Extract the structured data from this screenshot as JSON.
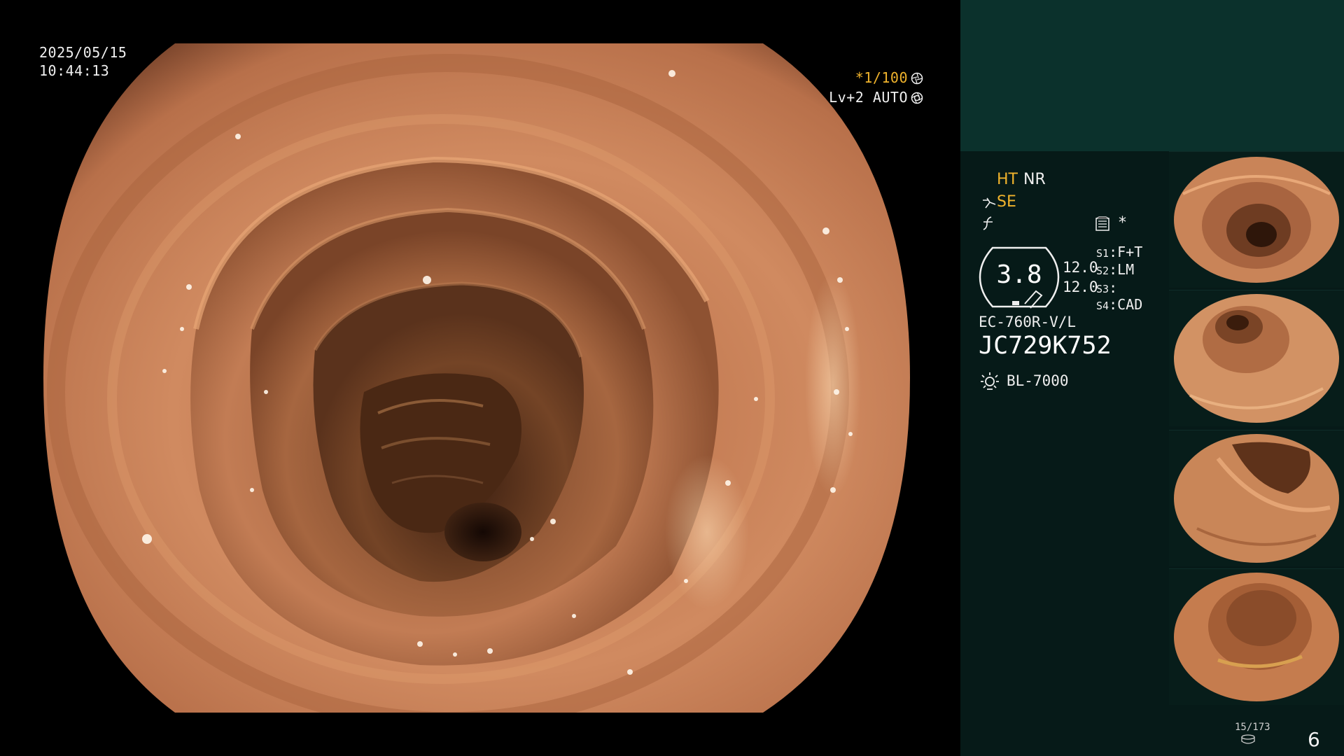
{
  "main_view": {
    "date": "2025/05/15",
    "time": "10:44:13",
    "shutter_prefix": "*",
    "shutter": "1/100",
    "level": "Lv+2",
    "exposure_mode": "AUTO",
    "icons": [
      "shutter-icon",
      "iris-icon"
    ]
  },
  "panel": {
    "modes": {
      "ht": "HT",
      "nr": "NR",
      "se": "SE"
    },
    "asterisk": "*",
    "gauge_value": "3.8",
    "values": [
      "12.0",
      "12.0"
    ],
    "slots": [
      {
        "key": "S1",
        "value": "F+T"
      },
      {
        "key": "S2",
        "value": "LM"
      },
      {
        "key": "S3",
        "value": ""
      },
      {
        "key": "S4",
        "value": "CAD"
      }
    ],
    "scope_model": "EC-760R-V/L",
    "scope_serial": "JC729K752",
    "light_source": "BL-7000",
    "thumbnail_count": 4,
    "image_counter": "15/173",
    "page_number": "6",
    "colors": {
      "accent_yellow": "#f0b32c",
      "panel_top": "#0b312c",
      "panel_bg": "#061a18",
      "text": "#efefef"
    }
  }
}
